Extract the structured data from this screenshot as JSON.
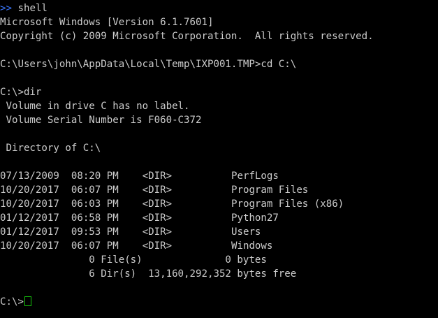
{
  "header": {
    "chevron": ">>",
    "title": "shell"
  },
  "banner": {
    "version": "Microsoft Windows [Version 6.1.7601]",
    "copyright": "Copyright (c) 2009 Microsoft Corporation.  All rights reserved."
  },
  "commands": {
    "cd": "C:\\Users\\john\\AppData\\Local\\Temp\\IXP001.TMP>cd C:\\",
    "dir": "C:\\>dir"
  },
  "volume": {
    "label": " Volume in drive C has no label.",
    "serial": " Volume Serial Number is F060-C372",
    "directory": " Directory of C:\\"
  },
  "listing": [
    {
      "date": "07/13/2009",
      "time": "08:20 PM",
      "type": "<DIR>",
      "name": "PerfLogs"
    },
    {
      "date": "10/20/2017",
      "time": "06:07 PM",
      "type": "<DIR>",
      "name": "Program Files"
    },
    {
      "date": "10/20/2017",
      "time": "06:03 PM",
      "type": "<DIR>",
      "name": "Program Files (x86)"
    },
    {
      "date": "01/12/2017",
      "time": "06:58 PM",
      "type": "<DIR>",
      "name": "Python27"
    },
    {
      "date": "01/12/2017",
      "time": "09:53 PM",
      "type": "<DIR>",
      "name": "Users"
    },
    {
      "date": "10/20/2017",
      "time": "06:07 PM",
      "type": "<DIR>",
      "name": "Windows"
    }
  ],
  "summary": {
    "files": "               0 File(s)              0 bytes",
    "dirs": "               6 Dir(s)  13,160,292,352 bytes free"
  },
  "prompt": {
    "text": "C:\\>"
  },
  "colors": {
    "background": "#000000",
    "text": "#cccccc",
    "chevron": "#3b78ff",
    "cursor": "#16c60c"
  }
}
